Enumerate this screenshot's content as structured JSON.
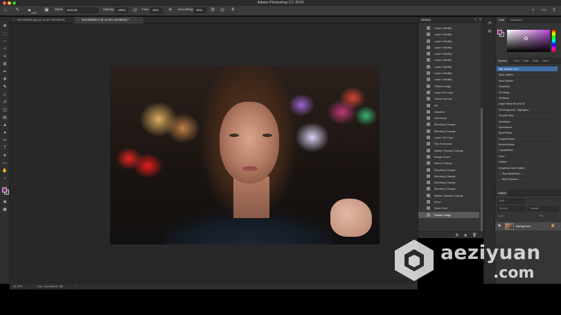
{
  "app": {
    "title": "Adobe Photoshop CC 2019"
  },
  "options": {
    "brush_size": "1000",
    "mode_label": "Mode:",
    "mode_value": "Normal",
    "opacity_label": "Opacity:",
    "opacity_value": "100%",
    "flow_label": "Flow:",
    "flow_value": "15%",
    "smoothing_label": "Smoothing:",
    "smoothing_value": "10%"
  },
  "tabs": [
    {
      "label": "DSC00609.jpg @ 11.5% (RGB/16)",
      "close": "×"
    },
    {
      "label": "DSC00609-2 @ 24.3% (RGB/16) *",
      "close": "×"
    }
  ],
  "status": {
    "zoom": "24.35%",
    "doc": "Doc: 141.8M/141.8M",
    "arrow": "›"
  },
  "history": {
    "title": "History",
    "items": [
      "Layer Visibility",
      "Layer Visibility",
      "Layer Visibility",
      "Layer Visibility",
      "Layer Visibility",
      "Layer Visibility",
      "Layer Visibility",
      "Layer Visibility",
      "Layer Visibility",
      "Flatten Image",
      "Layer Via Copy",
      "Select Canvas",
      "Fill",
      "Deselect",
      "Add Noise",
      "Blending Change",
      "Blending Change",
      "Layer Via Copy",
      "Flip Horizontal",
      "Master Opacity Change",
      "Merge Down",
      "Name Change",
      "Blending Change",
      "Blending Change",
      "Blending Change",
      "Blending Change",
      "Master Opacity Change",
      "Move",
      "Brush Tool",
      "Flatten Image"
    ]
  },
  "color": {
    "tabs": [
      "Color",
      "Swatches"
    ],
    "fg_color": "#8a2c8e",
    "bg_color": "#333333"
  },
  "actions": {
    "tabs": [
      "Actions",
      "Chan",
      "Path",
      "Adju",
      "Libra"
    ],
    "items": [
      "SBL Actions 10.4",
      "Spot Lighten",
      "Spot Darken",
      "Deepdark",
      "Fill White",
      "Fill Black",
      "Layer Mask Reveal All",
      "Fill foreground- Highlights",
      "Smooth Skin",
      "Neutralize",
      "Eyeframers",
      "Blue/Yellow",
      "Purple/Yellow",
      "Brown/Yellow",
      "CrystalClear",
      "Gren",
      "Flatten",
      "SnapShot then Flatten",
      "← Step Backward →",
      "→ Step Forward ←"
    ]
  },
  "layers": {
    "title": "Layers",
    "kind": "Kind",
    "blend": "Normal",
    "opacity": "Opacity:",
    "lock": "Lock:",
    "fill": "Fill:",
    "layer_name": "Background"
  },
  "watermark": {
    "line1": "aeziyuan",
    "line2": ".com"
  }
}
